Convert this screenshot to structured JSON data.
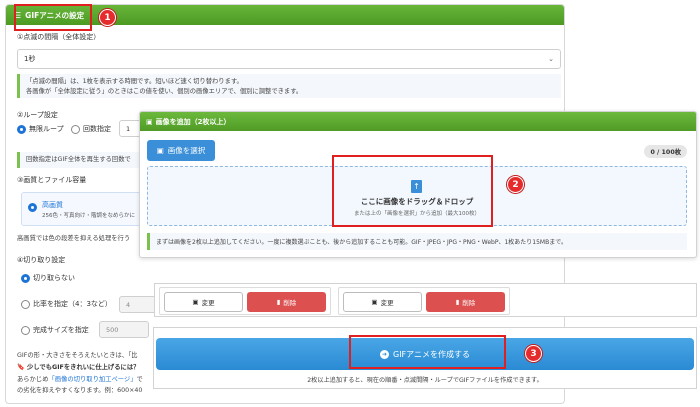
{
  "settings": {
    "header": "GIFアニメの設定",
    "section1_label": "①点滅の間隔（全体設定）",
    "interval_value": "1秒",
    "note1_line1": "「点滅の間隔」は、1枚を表示する時間です。短いほど速く切り替わります。",
    "note1_line2": "各画像が「全体設定に従う」のときはこの値を使い、個別の画像エリアで、個別に調整できます。",
    "section2_label": "②ループ設定",
    "loop_infinite": "無限ループ",
    "loop_count": "回数指定",
    "loop_count_value": "1",
    "note2": "回数指定はGIF全体を再生する回数で",
    "section3_label": "③画質とファイル容量",
    "quality_title": "高画質",
    "quality_sub": "256色・写真向け・階調をなめらかに",
    "quality_note": "高画質では色の段差を抑える処理を行う",
    "section4_label": "④切り取り設定",
    "crop_none": "切り取らない",
    "crop_ratio": "比率を指定（4：3など）",
    "crop_ratio_value": "4",
    "crop_size": "完成サイズを指定",
    "crop_size_value": "500",
    "bottom_line1": "GIFの形・大きさをそろえたいときは、「比",
    "bottom_line2": "🔖 少しでもGIFをきれいに仕上げるには？",
    "bottom_line3_a": "あらかじめ",
    "bottom_line3_link": "「画像の切り取り加工ページ」",
    "bottom_line3_b": "で",
    "bottom_line4": "の劣化を抑えやすくなります。例：600×40"
  },
  "upload": {
    "header": "画像を追加（2枚以上）",
    "select_button": "画像を選択",
    "count": "0 / 100枚",
    "drop_title": "ここに画像をドラッグ＆ドロップ",
    "drop_sub": "または上の「画像を選択」から追加（最大100枚）",
    "note": "まずは画像を2枚以上追加してください。一度に複数選ぶことも、後から追加することも可能。GIF・JPEG・JPG・PNG・WebP、1枚あたり15MBまで。"
  },
  "thumbs": {
    "change_label": "変更",
    "delete_label": "削除"
  },
  "create": {
    "button": "GIFアニメを作成する",
    "note": "2枚以上追加すると、現在の順番・点滅間隔・ループでGIFファイルを作成できます。"
  },
  "annotations": {
    "n1": "1",
    "n2": "2",
    "n3": "3"
  },
  "colors": {
    "green": "#5aa82e",
    "blue": "#3a8fd8",
    "red": "#dc5050",
    "highlight": "#e02020"
  }
}
